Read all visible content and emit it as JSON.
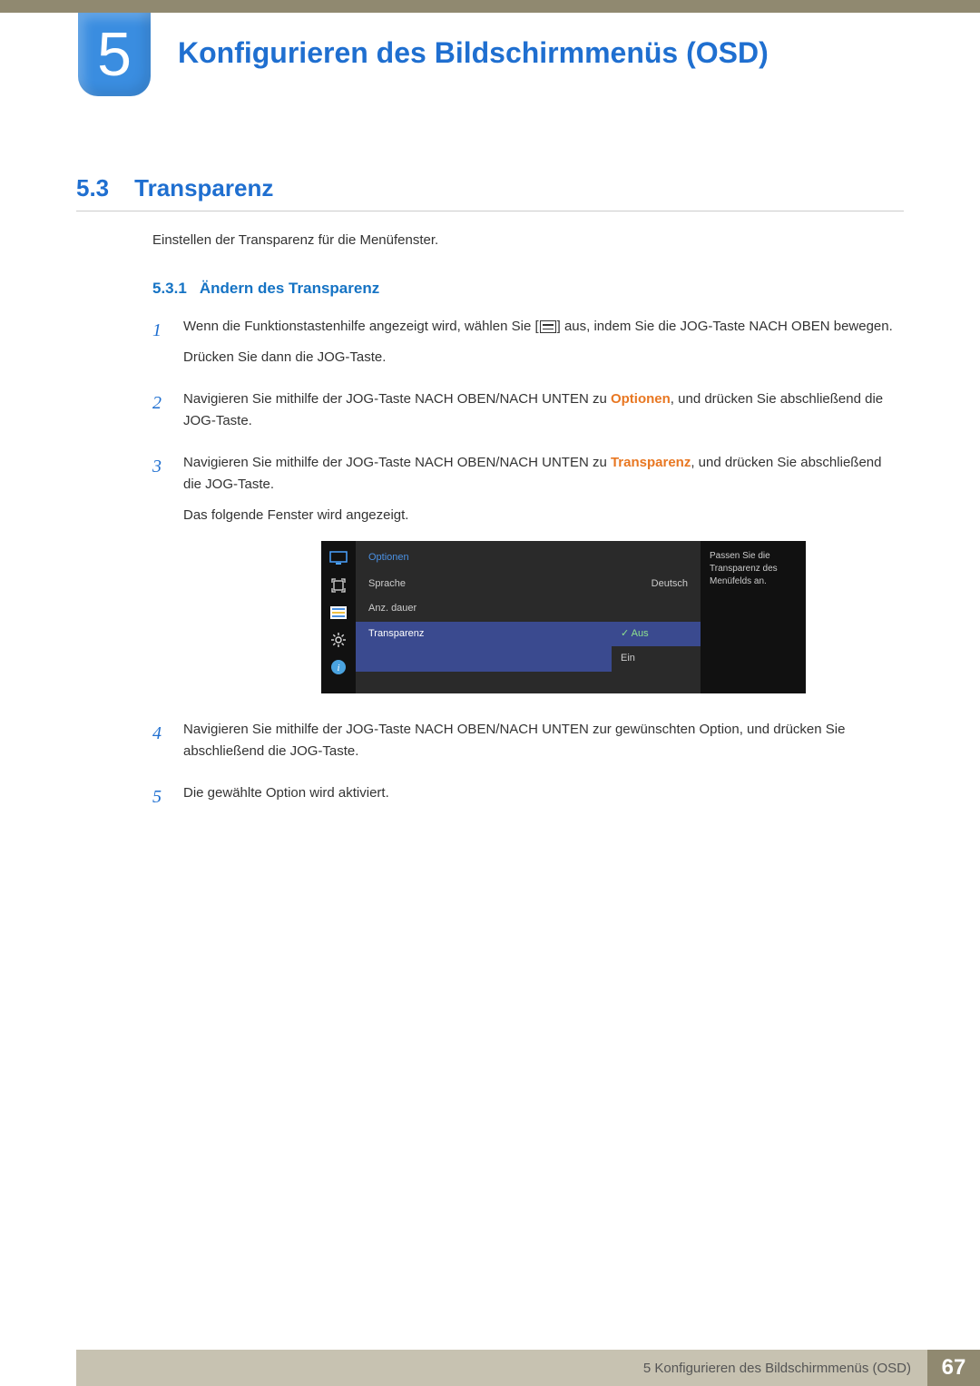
{
  "chapter": {
    "number": "5",
    "title": "Konfigurieren des Bildschirmmenüs (OSD)"
  },
  "section": {
    "number": "5.3",
    "title": "Transparenz",
    "description": "Einstellen der Transparenz für die Menüfenster."
  },
  "subsection": {
    "number": "5.3.1",
    "title": "Ändern des Transparenz"
  },
  "steps": {
    "s1": {
      "num": "1",
      "p1a": "Wenn die Funktionstastenhilfe angezeigt wird, wählen Sie [",
      "p1b": "] aus, indem Sie die JOG-Taste NACH OBEN bewegen.",
      "p2": "Drücken Sie dann die JOG-Taste."
    },
    "s2": {
      "num": "2",
      "p1a": "Navigieren Sie mithilfe der JOG-Taste NACH OBEN/NACH UNTEN zu ",
      "hl": "Optionen",
      "p1b": ", und drücken Sie abschließend die JOG-Taste."
    },
    "s3": {
      "num": "3",
      "p1a": "Navigieren Sie mithilfe der JOG-Taste NACH OBEN/NACH UNTEN zu ",
      "hl": "Transparenz",
      "p1b": ", und drücken Sie abschließend die JOG-Taste.",
      "p2": "Das folgende Fenster wird angezeigt."
    },
    "s4": {
      "num": "4",
      "text": "Navigieren Sie mithilfe der JOG-Taste NACH OBEN/NACH UNTEN zur gewünschten Option, und drücken Sie abschließend die JOG-Taste."
    },
    "s5": {
      "num": "5",
      "text": "Die gewählte Option wird aktiviert."
    }
  },
  "osd": {
    "heading": "Optionen",
    "rows": {
      "language_label": "Sprache",
      "language_value": "Deutsch",
      "duration_label": "Anz. dauer",
      "transparency_label": "Transparenz"
    },
    "options": {
      "off": "Aus",
      "on": "Ein"
    },
    "help": "Passen Sie die Transparenz des Menüfelds an."
  },
  "footer": {
    "text": "5 Konfigurieren des Bildschirmmenüs (OSD)",
    "page": "67"
  }
}
